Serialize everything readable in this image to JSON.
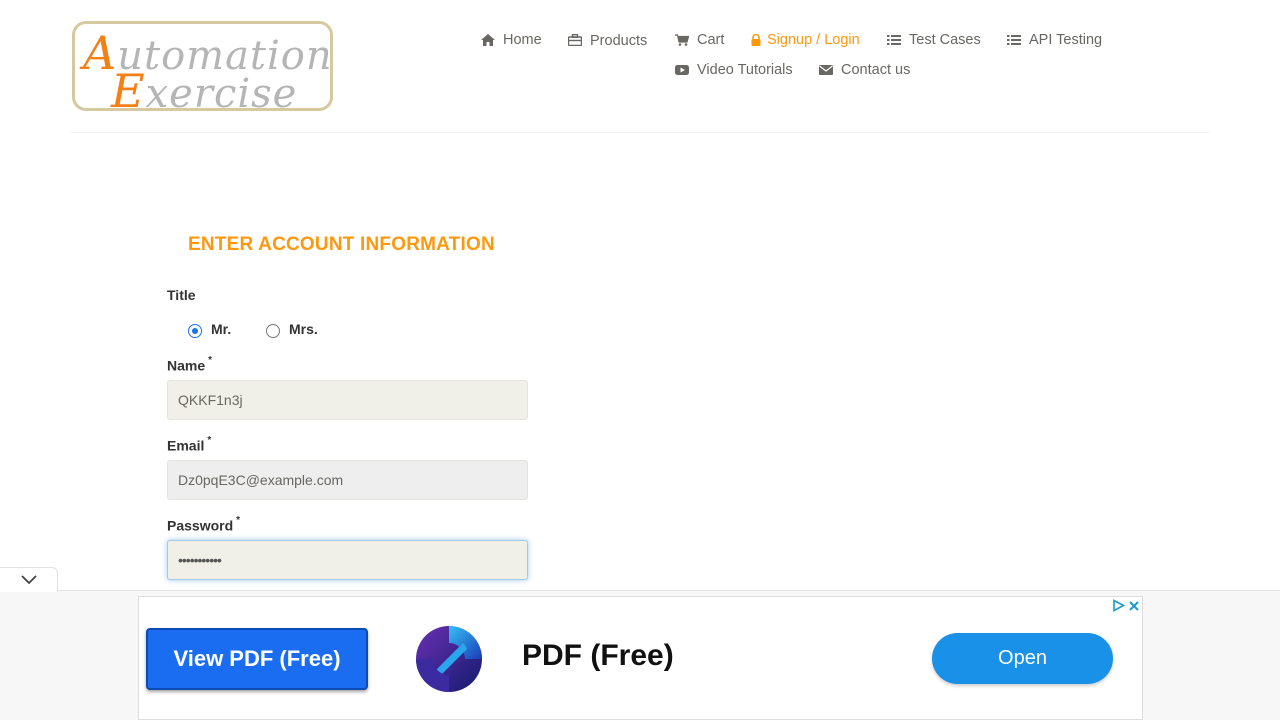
{
  "logo": {
    "line1_cap": "A",
    "line1_rest": "utomation",
    "line2_cap": "E",
    "line2_rest": "xercise"
  },
  "nav": {
    "home": "Home",
    "products": "Products",
    "cart": "Cart",
    "signup": "Signup / Login",
    "test_cases": "Test Cases",
    "api_testing": "API Testing",
    "video_tutorials": "Video Tutorials",
    "contact": "Contact us"
  },
  "form": {
    "heading": "ENTER ACCOUNT INFORMATION",
    "title_label": "Title",
    "title_options": [
      "Mr.",
      "Mrs."
    ],
    "title_selected": "Mr.",
    "name_label": "Name",
    "name_value": "QKKF1n3j",
    "email_label": "Email",
    "email_value": "Dz0pqE3C@example.com",
    "password_label": "Password",
    "password_value": "•••••••••••",
    "required_mark": "*"
  },
  "ad": {
    "left_button": "View PDF (Free)",
    "title": "PDF (Free)",
    "open_button": "Open"
  },
  "colors": {
    "accent": "#FE980F",
    "nav_text": "#696763",
    "ad_blue": "#1a91e8"
  }
}
